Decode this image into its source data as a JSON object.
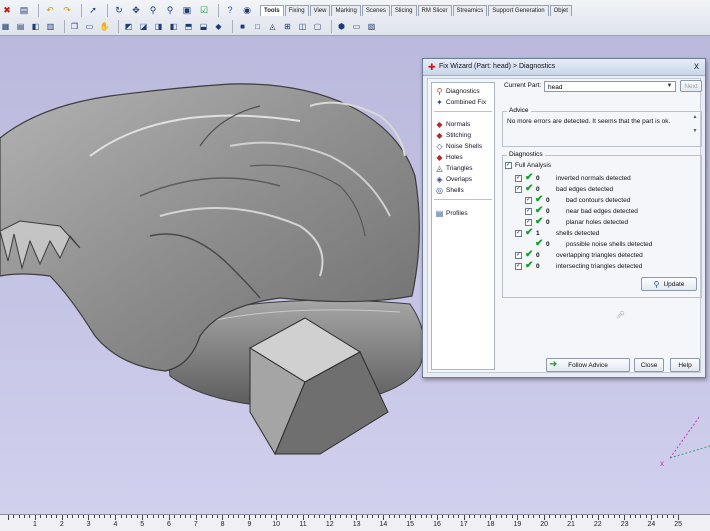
{
  "toolbar": {
    "tabs": [
      "Tools",
      "Fixing",
      "View",
      "Marking",
      "Scenes",
      "Slicing",
      "RM Slicer",
      "Streamics",
      "Support Generation",
      "Objet"
    ]
  },
  "ruler": {
    "numbers": [
      "1",
      "2",
      "3",
      "4",
      "5",
      "6",
      "7",
      "8",
      "9",
      "10",
      "11",
      "12",
      "13",
      "14",
      "15",
      "16",
      "17",
      "18",
      "19",
      "20",
      "21",
      "22",
      "23",
      "24",
      "25"
    ]
  },
  "dialog": {
    "title": "Fix Wizard (Part: head) > Diagnostics",
    "close": "x",
    "sidebar": {
      "diagnostics": "Diagnostics",
      "combined_fix": "Combined Fix",
      "normals": "Normals",
      "stitching": "Stitching",
      "noise_shells": "Noise Shells",
      "holes": "Holes",
      "triangles": "Triangles",
      "overlaps": "Overlaps",
      "shells": "Shells",
      "profiles": "Profiles"
    },
    "current_part_label": "Current Part:",
    "current_part_value": "head",
    "next_label": "Next",
    "advice": {
      "title": "Advice",
      "text": "No more errors are detected. It seems that the part is ok."
    },
    "diagnostics": {
      "title": "Diagnostics",
      "full_analysis": "Full Analysis",
      "rows": [
        {
          "count": "0",
          "label": "inverted normals detected"
        },
        {
          "count": "0",
          "label": "bad edges detected"
        },
        {
          "count": "0",
          "label": "bad contours detected"
        },
        {
          "count": "0",
          "label": "near bad edges detected"
        },
        {
          "count": "0",
          "label": "planar holes detected"
        },
        {
          "count": "1",
          "label": "shells detected"
        },
        {
          "count": "0",
          "label": "possible noise shells detected"
        },
        {
          "count": "0",
          "label": "overlapping triangles detected"
        },
        {
          "count": "0",
          "label": "intersecting triangles detected"
        }
      ],
      "update_label": "Update"
    },
    "footer": {
      "follow_advice": "Follow Advice",
      "close": "Close",
      "help": "Help"
    }
  }
}
